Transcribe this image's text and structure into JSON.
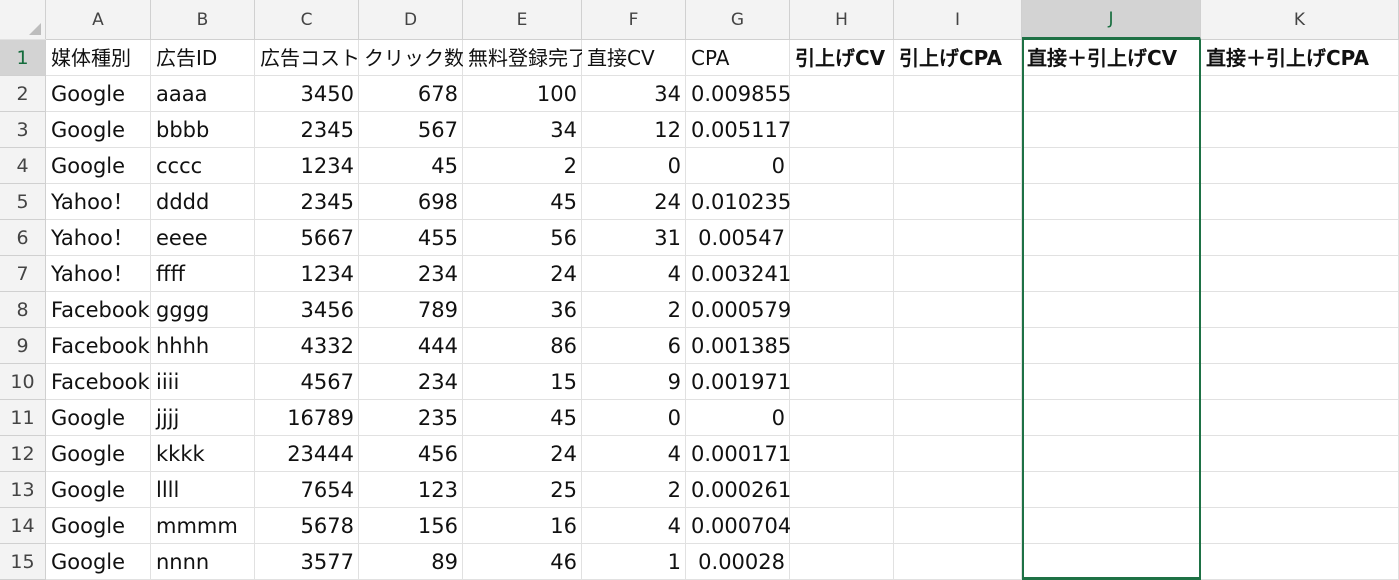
{
  "columns": [
    "A",
    "B",
    "C",
    "D",
    "E",
    "F",
    "G",
    "H",
    "I",
    "J",
    "K"
  ],
  "selected_column": "J",
  "header_row": {
    "row": "1",
    "cells": [
      "媒体種別",
      "広告ID",
      "広告コスト",
      "クリック数",
      "無料登録完了",
      "直接CV",
      "CPA",
      "引上げCV",
      "引上げCPA",
      "直接＋引上げCV",
      "直接＋引上げCPA"
    ]
  },
  "rows": [
    {
      "row": "2",
      "cells": [
        "Google",
        "aaaa",
        "3450",
        "678",
        "100",
        "34",
        "0.009855",
        "",
        "",
        "",
        ""
      ]
    },
    {
      "row": "3",
      "cells": [
        "Google",
        "bbbb",
        "2345",
        "567",
        "34",
        "12",
        "0.005117",
        "",
        "",
        "",
        ""
      ]
    },
    {
      "row": "4",
      "cells": [
        "Google",
        "cccc",
        "1234",
        "45",
        "2",
        "0",
        "0",
        "",
        "",
        "",
        ""
      ]
    },
    {
      "row": "5",
      "cells": [
        "Yahoo！",
        "dddd",
        "2345",
        "698",
        "45",
        "24",
        "0.010235",
        "",
        "",
        "",
        ""
      ]
    },
    {
      "row": "6",
      "cells": [
        "Yahoo！",
        "eeee",
        "5667",
        "455",
        "56",
        "31",
        "0.00547",
        "",
        "",
        "",
        ""
      ]
    },
    {
      "row": "7",
      "cells": [
        "Yahoo！",
        "ffff",
        "1234",
        "234",
        "24",
        "4",
        "0.003241",
        "",
        "",
        "",
        ""
      ]
    },
    {
      "row": "8",
      "cells": [
        "Facebook",
        "gggg",
        "3456",
        "789",
        "36",
        "2",
        "0.000579",
        "",
        "",
        "",
        ""
      ]
    },
    {
      "row": "9",
      "cells": [
        "Facebook",
        "hhhh",
        "4332",
        "444",
        "86",
        "6",
        "0.001385",
        "",
        "",
        "",
        ""
      ]
    },
    {
      "row": "10",
      "cells": [
        "Facebook",
        "iiii",
        "4567",
        "234",
        "15",
        "9",
        "0.001971",
        "",
        "",
        "",
        ""
      ]
    },
    {
      "row": "11",
      "cells": [
        "Google",
        "jjjj",
        "16789",
        "235",
        "45",
        "0",
        "0",
        "",
        "",
        "",
        ""
      ]
    },
    {
      "row": "12",
      "cells": [
        "Google",
        "kkkk",
        "23444",
        "456",
        "24",
        "4",
        "0.000171",
        "",
        "",
        "",
        ""
      ]
    },
    {
      "row": "13",
      "cells": [
        "Google",
        "llll",
        "7654",
        "123",
        "25",
        "2",
        "0.000261",
        "",
        "",
        "",
        ""
      ]
    },
    {
      "row": "14",
      "cells": [
        "Google",
        "mmmm",
        "5678",
        "156",
        "16",
        "4",
        "0.000704",
        "",
        "",
        "",
        ""
      ]
    },
    {
      "row": "15",
      "cells": [
        "Google",
        "nnnn",
        "3577",
        "89",
        "46",
        "1",
        "0.00028",
        "",
        "",
        "",
        ""
      ]
    }
  ],
  "colors": {
    "header_bg": "#f3f3f3",
    "selected_header_bg": "#d3d3d3",
    "selection_accent": "#1e7145",
    "gridline": "#e1e1e1"
  }
}
